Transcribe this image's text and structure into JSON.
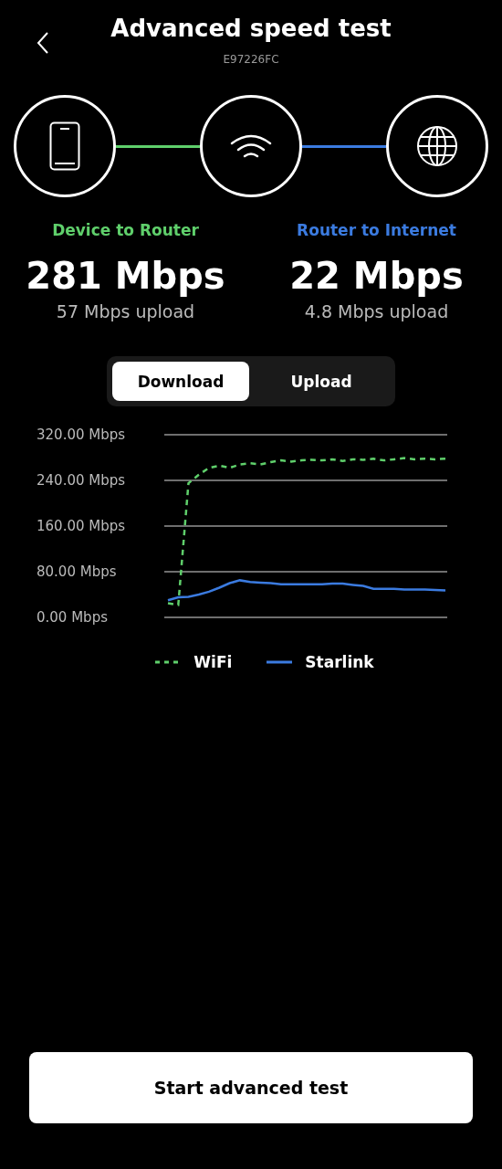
{
  "header": {
    "title": "Advanced speed test",
    "subtitle": "E97226FC"
  },
  "links": [
    {
      "kind": "phone",
      "color": "#5fcf6b"
    },
    {
      "kind": "wifi",
      "color": "#3b7be0"
    },
    {
      "kind": "globe"
    }
  ],
  "metrics": [
    {
      "label": "Device to Router",
      "color": "#5fcf6b",
      "download": "281 Mbps",
      "upload": "57 Mbps upload"
    },
    {
      "label": "Router to Internet",
      "color": "#3b7be0",
      "download": "22 Mbps",
      "upload": "4.8 Mbps upload"
    }
  ],
  "tabs": [
    {
      "label": "Download",
      "selected": true
    },
    {
      "label": "Upload",
      "selected": false
    }
  ],
  "chart": {
    "chart_data": {
      "type": "line",
      "grid": true,
      "ylim": [
        0,
        320
      ],
      "yticks": [
        {
          "value": 0,
          "label": "0.00 Mbps"
        },
        {
          "value": 80,
          "label": "80.00 Mbps"
        },
        {
          "value": 160,
          "label": "160.00 Mbps"
        },
        {
          "value": 240,
          "label": "240.00 Mbps"
        },
        {
          "value": 320,
          "label": "320.00 Mbps"
        }
      ],
      "series": [
        {
          "name": "WiFi",
          "color": "#5fcf6b",
          "line_style": "dashed",
          "values": [
            25,
            22,
            235,
            250,
            262,
            266,
            262,
            268,
            270,
            268,
            272,
            275,
            273,
            275,
            276,
            275,
            277,
            274,
            277,
            276,
            278,
            275,
            277,
            279,
            277,
            278,
            277,
            278
          ]
        },
        {
          "name": "Starlink",
          "color": "#3b7be0",
          "line_style": "solid",
          "values": [
            30,
            35,
            36,
            40,
            45,
            52,
            60,
            65,
            62,
            61,
            60,
            58,
            58,
            58,
            58,
            58,
            59,
            59,
            57,
            55,
            50,
            50,
            50,
            49,
            49,
            49,
            48,
            47
          ]
        }
      ]
    }
  },
  "button": "Start advanced test"
}
